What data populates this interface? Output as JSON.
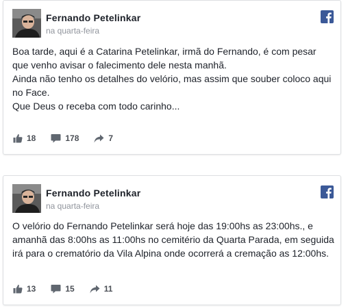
{
  "posts": [
    {
      "author": "Fernando Petelinkar",
      "time": "na quarta-feira",
      "avatar_icon": "profile-photo",
      "platform_icon": "facebook-icon",
      "brand_color": "#3b5998",
      "lines": [
        "Boa tarde, aqui é a Catarina Petelinkar, irmã do Fernando, é com pesar que venho avisar o falecimento dele nesta manhã.",
        "Ainda não tenho os detalhes do velório, mas assim que souber coloco aqui no Face.",
        "Que Deus o receba com todo carinho..."
      ],
      "likes": "18",
      "comments": "178",
      "shares": "7"
    },
    {
      "author": "Fernando Petelinkar",
      "time": "na quarta-feira",
      "avatar_icon": "profile-photo",
      "platform_icon": "facebook-icon",
      "brand_color": "#3b5998",
      "lines": [
        "O velório do Fernando Petelinkar será hoje das 19:00hs as 23:00hs., e amanhã das 8:00hs as 11:00hs no cemitério da Quarta Parada, em seguida irá para o crematório da Vila Alpina onde ocorrerá a cremação as 12:00hs."
      ],
      "likes": "13",
      "comments": "15",
      "shares": "11"
    }
  ]
}
